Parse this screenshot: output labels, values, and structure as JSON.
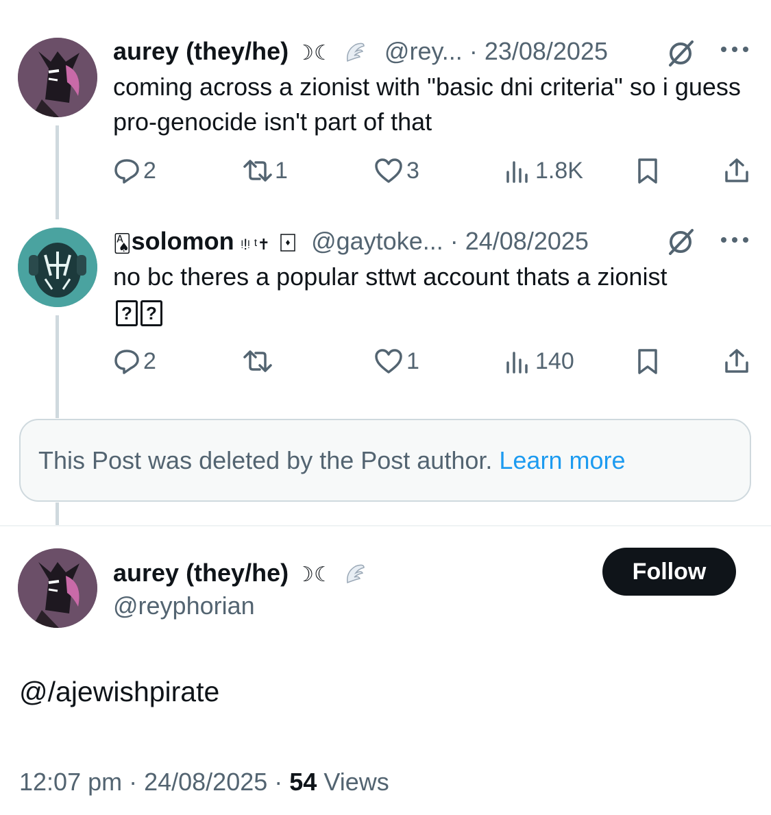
{
  "tweet1": {
    "name": "aurey (they/he)",
    "name_glyphs": "☽☾",
    "handle": "@rey...",
    "date": "· 23/08/2025",
    "text": "coming across a zionist with \"basic dni criteria\" so i guess pro-genocide isn't part of that",
    "replies": "2",
    "reposts": "1",
    "likes": "3",
    "views": "1.8K"
  },
  "tweet2": {
    "name": "solomon",
    "name_prefix_glyph": "🂡",
    "name_suffix_glyphs": "ᵎ!ᵎ ᵗ✝",
    "handle": "@gaytoke...",
    "date": "· 24/08/2025",
    "text": "no bc theres a popular sttwt account thats a zionist",
    "replies": "2",
    "reposts": "",
    "likes": "1",
    "views": "140"
  },
  "deleted": {
    "message": "This Post was deleted by the Post author.",
    "link": "Learn more"
  },
  "main": {
    "name": "aurey (they/he)",
    "name_glyphs": "☽☾",
    "handle": "@reyphorian",
    "follow_label": "Follow",
    "text": "@/ajewishpirate",
    "time_date": "12:07 pm · 24/08/2025 ·",
    "views_count": "54",
    "views_label": "Views"
  },
  "colors": {
    "text": "#0f1419",
    "secondary": "#536471",
    "link": "#1d9bf0",
    "border": "#cfd9de"
  },
  "icons": [
    "reply-icon",
    "repost-icon",
    "like-icon",
    "views-icon",
    "bookmark-icon",
    "share-icon",
    "grok-icon",
    "more-icon",
    "wing-icon"
  ]
}
